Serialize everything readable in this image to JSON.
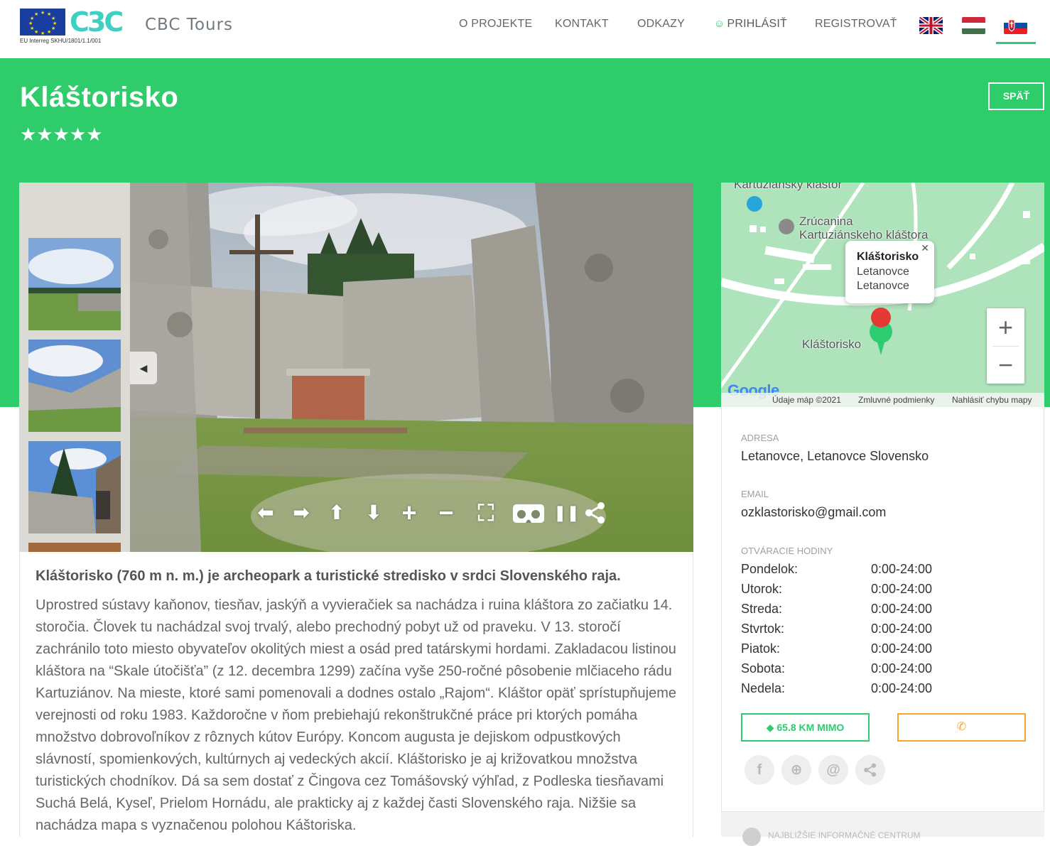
{
  "header": {
    "eu_caption": "EU Interreg SKHU/1801/1.1/001",
    "logo_mark": "C3C",
    "logo_text": "CBC Tours",
    "nav": [
      {
        "label": "O PROJEKTE"
      },
      {
        "label": "KONTAKT"
      },
      {
        "label": "ODKAZY"
      },
      {
        "label": "PRIHLÁSIŤ",
        "icon": "user-icon"
      },
      {
        "label": "REGISTROVAŤ"
      }
    ],
    "languages": [
      "english-flag-icon",
      "hungarian-flag-icon",
      "slovak-flag-icon"
    ],
    "active_language": "slovak-flag-icon"
  },
  "hero": {
    "title": "Kláštorisko",
    "rating": 5,
    "stars": "★★★★★",
    "back_label": "SPÄŤ"
  },
  "gallery": {
    "collapse_icon": "◀",
    "controls": [
      {
        "name": "pan-left-icon",
        "glyph": "⬅"
      },
      {
        "name": "pan-right-icon",
        "glyph": "➡"
      },
      {
        "name": "pan-up-icon",
        "glyph": "⬆"
      },
      {
        "name": "pan-down-icon",
        "glyph": "⬇"
      },
      {
        "name": "zoom-in-icon",
        "glyph": "+"
      },
      {
        "name": "zoom-out-icon",
        "glyph": "−"
      },
      {
        "name": "fullscreen-icon",
        "glyph": "⛶"
      },
      {
        "name": "vr-headset-icon",
        "glyph": "▣"
      },
      {
        "name": "pause-icon",
        "glyph": "❚❚"
      },
      {
        "name": "share-icon",
        "glyph": "⋖"
      }
    ]
  },
  "description": {
    "lead": "Kláštorisko (760 m n. m.) je archeopark a turistické stredisko v srdci Slovenského raja.",
    "body": "Uprostred sústavy kaňonov, tiesňav, jaskýň a vyvieračiek sa nachádza i ruina kláštora zo začiatku 14. storočia. Človek tu nachádzal svoj trvalý, alebo prechodný pobyt už od praveku. V 13. storočí zachránilo toto miesto obyvateľov okolitých miest a osád pred tatárskymi hordami. Zakladacou listinou kláštora na “Skale útočišťa” (z 12. decembra 1299) začína vyše 250-ročné pôsobenie mlčiaceho rádu Kartuziánov. Na mieste, ktoré sami pomenovali a dodnes ostalo „Rajom“. Kláštor opäť sprístupňujeme verejnosti od roku 1983. Každoročne v ňom prebiehajú rekonštrukčné práce pri ktorých pomáha množstvo dobrovoľníkov z rôznych kútov Európy. Koncom augusta je dejiskom odpustkových slávností, spomienkových, kultúrnych aj vedeckých akcií. Kláštorisko je aj križovatkou množstva turistických chodníkov. Dá sa sem dostať z Čingova cez Tomášovský výhľad, z Podleska tiesňavami Suchá Belá, Kyseľ, Prielom Hornádu, ale prakticky aj z každej časti Slovenského raja. Nižšie sa nachádza mapa s vyznačenou polohou Káštoriska."
  },
  "map": {
    "label_top": "Kartuziánsky kláštor",
    "label_ruin_1": "Zrúcanina",
    "label_ruin_2": "Kartuziánskeho kláštora",
    "label_marker": "Kláštorisko",
    "infowindow": {
      "title": "Kláštorisko",
      "line1": "Letanovce",
      "line2": "Letanovce",
      "close": "✕"
    },
    "zoom_in": "+",
    "zoom_out": "−",
    "google": "Google",
    "footer": {
      "data": "Údaje máp ©2021",
      "terms": "Zmluvné podmienky",
      "report": "Nahlásiť chybu mapy"
    }
  },
  "info": {
    "address_label": "ADRESA",
    "address": "Letanovce, Letanovce Slovensko",
    "email_label": "EMAIL",
    "email": "ozklastorisko@gmail.com",
    "hours_label": "OTVÁRACIE HODINY",
    "hours": [
      {
        "day": "Pondelok:",
        "time": "0:00-24:00"
      },
      {
        "day": "Utorok:",
        "time": "0:00-24:00"
      },
      {
        "day": "Streda:",
        "time": "0:00-24:00"
      },
      {
        "day": "Stvrtok:",
        "time": "0:00-24:00"
      },
      {
        "day": "Piatok:",
        "time": "0:00-24:00"
      },
      {
        "day": "Sobota:",
        "time": "0:00-24:00"
      },
      {
        "day": "Nedela:",
        "time": "0:00-24:00"
      }
    ],
    "distance": "65.8 KM MIMO",
    "distance_icon": "◆",
    "phone_icon": "✆",
    "social": [
      {
        "name": "facebook-icon",
        "glyph": "f"
      },
      {
        "name": "globe-icon",
        "glyph": "⊕"
      },
      {
        "name": "at-sign-icon",
        "glyph": "@"
      },
      {
        "name": "share-icon",
        "glyph": "⋖"
      }
    ],
    "nearest_info": "NAJBLIŽŠIE INFORMAČNÉ CENTRUM"
  },
  "colors": {
    "accent": "#2ecc71",
    "hero": "#2ecc6a",
    "phone": "#f5a623"
  }
}
